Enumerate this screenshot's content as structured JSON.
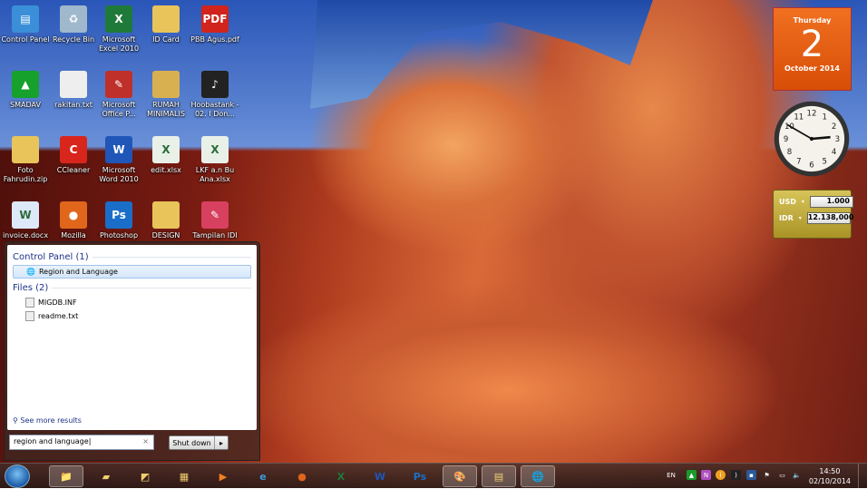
{
  "desktop": {
    "icons": [
      {
        "label": "Control Panel",
        "icon": "control-panel-icon",
        "color": "#3a8fd8",
        "glyph": "▤"
      },
      {
        "label": "Recycle Bin",
        "icon": "recycle-bin-icon",
        "color": "#9fb8cc",
        "glyph": "♻"
      },
      {
        "label": "Microsoft Excel 2010",
        "icon": "excel-icon",
        "color": "#1f7a3a",
        "glyph": "X"
      },
      {
        "label": "ID Card",
        "icon": "folder-icon",
        "color": "#e8c45a",
        "glyph": ""
      },
      {
        "label": "PBB Agus.pdf",
        "icon": "pdf-icon",
        "color": "#d0241c",
        "glyph": "PDF"
      },
      {
        "label": "SMADAV",
        "icon": "smadav-icon",
        "color": "#16a02c",
        "glyph": "▲"
      },
      {
        "label": "rakitan.txt",
        "icon": "text-file-icon",
        "color": "#eeeeee",
        "glyph": ""
      },
      {
        "label": "Microsoft Office P...",
        "icon": "picture-manager-icon",
        "color": "#c0302a",
        "glyph": "✎"
      },
      {
        "label": "RUMAH MINIMALIS",
        "icon": "folder-icon",
        "color": "#d9b050",
        "glyph": ""
      },
      {
        "label": "Hoobastank - 02. I Don...",
        "icon": "music-file-icon",
        "color": "#222222",
        "glyph": "♪"
      },
      {
        "label": "Foto Fahrudin.zip",
        "icon": "zip-folder-icon",
        "color": "#e8c45a",
        "glyph": ""
      },
      {
        "label": "CCleaner",
        "icon": "ccleaner-icon",
        "color": "#d8261c",
        "glyph": "C"
      },
      {
        "label": "Microsoft Word 2010",
        "icon": "word-icon",
        "color": "#1f56b8",
        "glyph": "W"
      },
      {
        "label": "edit.xlsx",
        "icon": "excel-file-icon",
        "color": "#e8f0e8",
        "glyph": "X"
      },
      {
        "label": "LKF a.n Bu Ana.xlsx",
        "icon": "excel-file-icon",
        "color": "#e8f0e8",
        "glyph": "X"
      },
      {
        "label": "invoice.docx",
        "icon": "word-file-icon",
        "color": "#dde8f8",
        "glyph": "W"
      },
      {
        "label": "Mozilla",
        "icon": "firefox-icon",
        "color": "#e0661c",
        "glyph": "●"
      },
      {
        "label": "Photoshop",
        "icon": "photoshop-icon",
        "color": "#1a6ec8",
        "glyph": "Ps"
      },
      {
        "label": "DESIGN",
        "icon": "folder-icon",
        "color": "#e8c45a",
        "glyph": ""
      },
      {
        "label": "Tampilan IDI",
        "icon": "eraser-icon",
        "color": "#d84060",
        "glyph": "✎"
      }
    ]
  },
  "start_menu": {
    "groups": [
      {
        "header": "Control Panel (1)",
        "items": [
          {
            "label": "Region and Language",
            "selected": true
          }
        ]
      },
      {
        "header": "Files (2)",
        "items": [
          {
            "label": "MIGDB.INF",
            "selected": false
          },
          {
            "label": "readme.txt",
            "selected": false
          }
        ]
      }
    ],
    "see_more": "See more results",
    "search_value": "region and language",
    "clear": "×",
    "shutdown": "Shut down",
    "shutdown_arrow": "▸"
  },
  "taskbar": {
    "pinned": [
      {
        "name": "windows-explorer",
        "glyph": "📁",
        "active": true
      },
      {
        "name": "sticky-notes",
        "glyph": "▰",
        "active": false
      },
      {
        "name": "snipping-tool",
        "glyph": "◩",
        "active": false
      },
      {
        "name": "calculator",
        "glyph": "▦",
        "active": false
      },
      {
        "name": "media-player",
        "glyph": "▶",
        "active": false
      },
      {
        "name": "internet-explorer",
        "glyph": "e",
        "active": false
      },
      {
        "name": "firefox",
        "glyph": "●",
        "active": false
      },
      {
        "name": "excel",
        "glyph": "X",
        "active": false
      },
      {
        "name": "word",
        "glyph": "W",
        "active": false
      },
      {
        "name": "photoshop",
        "glyph": "Ps",
        "active": false
      },
      {
        "name": "paint",
        "glyph": "🎨",
        "active": true
      },
      {
        "name": "control-panel",
        "glyph": "▤",
        "active": true
      },
      {
        "name": "region-language",
        "glyph": "🌐",
        "active": true
      }
    ],
    "language": "EN",
    "time": "14:50",
    "date": "02/10/2014"
  },
  "gadgets": {
    "calendar": {
      "weekday": "Thursday",
      "day": "2",
      "month_year": "October 2014"
    },
    "clock": {
      "hour": 14,
      "minute": 50
    },
    "currency": {
      "from": "USD",
      "from_value": "1.000",
      "to": "IDR",
      "to_value": "12.138,000"
    }
  }
}
